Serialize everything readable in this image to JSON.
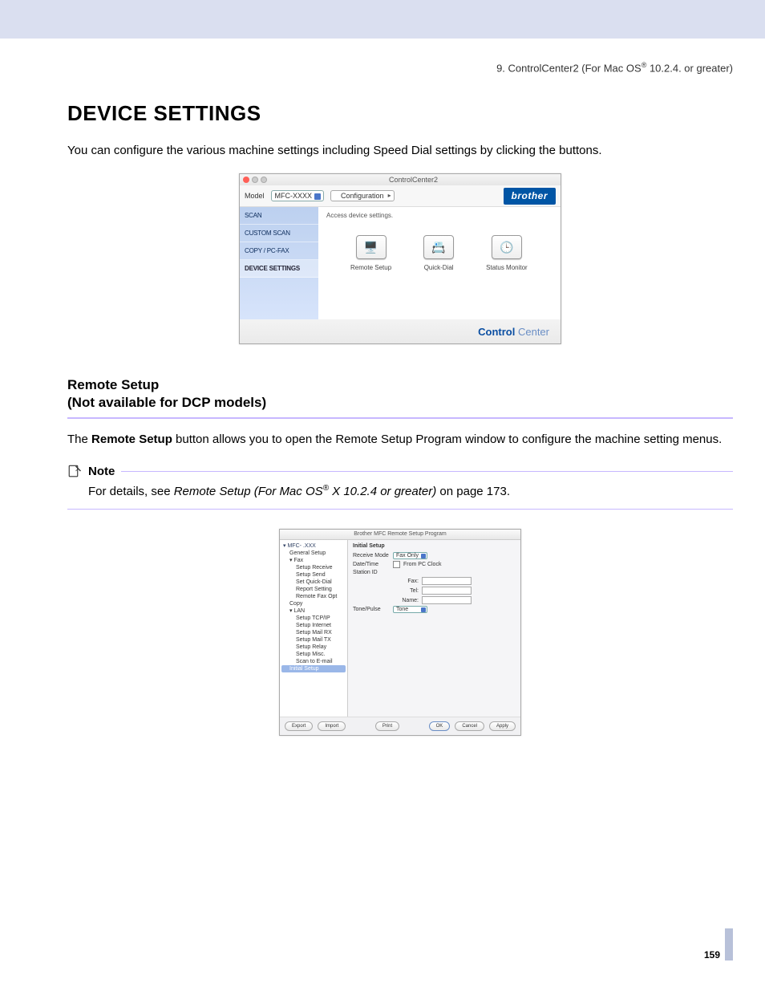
{
  "header": {
    "chapter_prefix": "9. ControlCenter2 (For Mac OS",
    "reg": "®",
    "chapter_suffix": " 10.2.4. or greater)"
  },
  "title": "DEVICE SETTINGS",
  "intro": "You can configure the various machine settings including Speed Dial settings by clicking the buttons.",
  "fig1": {
    "window_title": "ControlCenter2",
    "model_label": "Model",
    "model_value": "MFC-XXXX",
    "config_button": "Configuration",
    "brand": "brother",
    "sidebar": [
      "SCAN",
      "CUSTOM SCAN",
      "COPY / PC-FAX",
      "DEVICE SETTINGS"
    ],
    "desc": "Access device settings.",
    "icons": {
      "remote": "Remote Setup",
      "quick": "Quick-Dial",
      "status": "Status Monitor"
    },
    "footer_bold": "Control",
    "footer_light": " Center"
  },
  "subheading_line1": "Remote Setup",
  "subheading_line2": "(Not available for DCP models)",
  "body_before_bold": "The ",
  "body_bold": "Remote Setup",
  "body_after_bold": " button allows you to open the Remote Setup Program window to configure the machine setting menus.",
  "note": {
    "label": "Note",
    "text_before_italic": "For details, see ",
    "italic_before_reg": "Remote Setup (For Mac OS",
    "reg": "®",
    "italic_after_reg": " X 10.2.4 or greater)",
    "text_after_italic": " on page 173."
  },
  "fig2": {
    "window_title": "Brother MFC Remote Setup Program",
    "tree": {
      "root": "▾ MFC- .XXX",
      "general": "General Setup",
      "fax": "▾ Fax",
      "fax_children": [
        "Setup Receive",
        "Setup Send",
        "Set Quick-Dial",
        "Report Setting",
        "Remote Fax Opt"
      ],
      "copy": "Copy",
      "lan": "▾ LAN",
      "lan_children": [
        "Setup TCP/IP",
        "Setup Internet",
        "Setup Mail RX",
        "Setup Mail TX",
        "Setup Relay",
        "Setup Misc.",
        "Scan to E-mail"
      ],
      "initial": "Initial Setup"
    },
    "form": {
      "title": "Initial Setup",
      "receive_mode_label": "Receive Mode",
      "receive_mode_value": "Fax Only",
      "date_time_label": "Date/Time",
      "date_time_value": "From PC Clock",
      "station_id_label": "Station ID",
      "fax_label": "Fax:",
      "tel_label": "Tel:",
      "name_label": "Name:",
      "tone_pulse_label": "Tone/Pulse",
      "tone_pulse_value": "Tone"
    },
    "buttons": {
      "export": "Export",
      "import": "Import",
      "print": "Print",
      "ok": "OK",
      "cancel": "Cancel",
      "apply": "Apply"
    }
  },
  "page_number": "159"
}
